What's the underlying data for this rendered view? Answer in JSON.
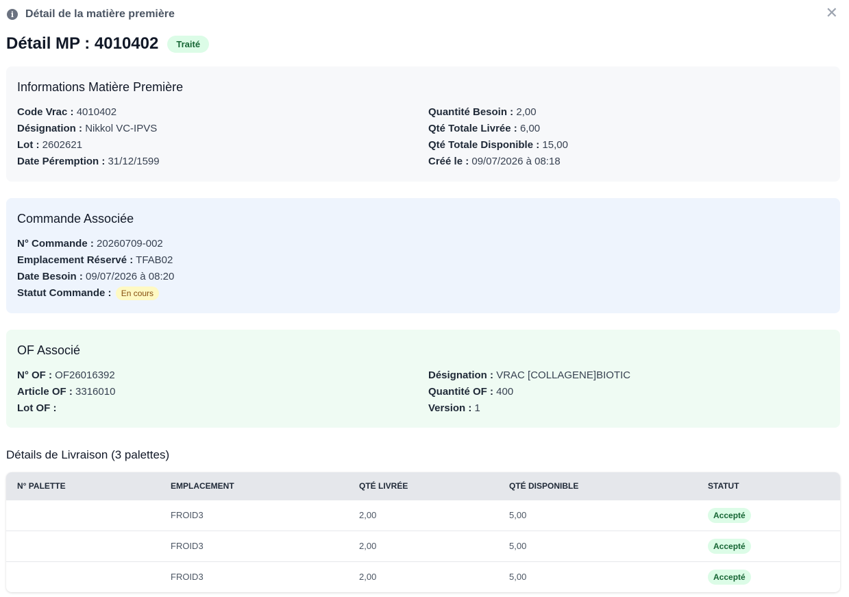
{
  "header": {
    "title": "Détail de la matière première",
    "close_icon": "close-icon",
    "info_icon": "info-icon"
  },
  "page": {
    "title": "Détail MP : 4010402",
    "status": "Traité"
  },
  "mp_section": {
    "title": "Informations Matière Première",
    "left": [
      {
        "label": "Code Vrac :",
        "value": "4010402"
      },
      {
        "label": "Désignation :",
        "value": "Nikkol VC-IPVS"
      },
      {
        "label": "Lot :",
        "value": "2602621"
      },
      {
        "label": "Date Péremption :",
        "value": "31/12/1599"
      }
    ],
    "right": [
      {
        "label": "Quantité Besoin :",
        "value": "2,00"
      },
      {
        "label": "Qté Totale Livrée :",
        "value": "6,00"
      },
      {
        "label": "Qté Totale Disponible :",
        "value": "15,00"
      },
      {
        "label": "Créé le :",
        "value": "09/07/2026 à 08:18"
      }
    ]
  },
  "order_section": {
    "title": "Commande Associée",
    "rows": [
      {
        "label": "N° Commande :",
        "value": "20260709-002"
      },
      {
        "label": "Emplacement Réservé :",
        "value": "TFAB02"
      },
      {
        "label": "Date Besoin :",
        "value": "09/07/2026 à 08:20"
      }
    ],
    "status_label": "Statut Commande :",
    "status_value": "En cours"
  },
  "of_section": {
    "title": "OF Associé",
    "left": [
      {
        "label": "N° OF :",
        "value": "OF26016392"
      },
      {
        "label": "Article OF :",
        "value": "3316010"
      },
      {
        "label": "Lot OF :",
        "value": ""
      }
    ],
    "right": [
      {
        "label": "Désignation :",
        "value": "VRAC [COLLAGENE]BIOTIC"
      },
      {
        "label": "Quantité OF :",
        "value": "400"
      },
      {
        "label": "Version :",
        "value": "1"
      }
    ]
  },
  "delivery": {
    "title": "Détails de Livraison (3 palettes)",
    "columns": [
      "N° PALETTE",
      "EMPLACEMENT",
      "QTÉ LIVRÉE",
      "QTÉ DISPONIBLE",
      "STATUT"
    ],
    "rows": [
      {
        "palette": "",
        "location": "FROID3",
        "delivered": "2,00",
        "available": "5,00",
        "status": "Accepté"
      },
      {
        "palette": "",
        "location": "FROID3",
        "delivered": "2,00",
        "available": "5,00",
        "status": "Accepté"
      },
      {
        "palette": "",
        "location": "FROID3",
        "delivered": "2,00",
        "available": "5,00",
        "status": "Accepté"
      }
    ]
  },
  "colors": {
    "treated_bg": "#dcfce7",
    "in_progress_bg": "#fef9c3",
    "order_card_bg": "#eef4fd",
    "of_card_bg": "#effbf3"
  }
}
